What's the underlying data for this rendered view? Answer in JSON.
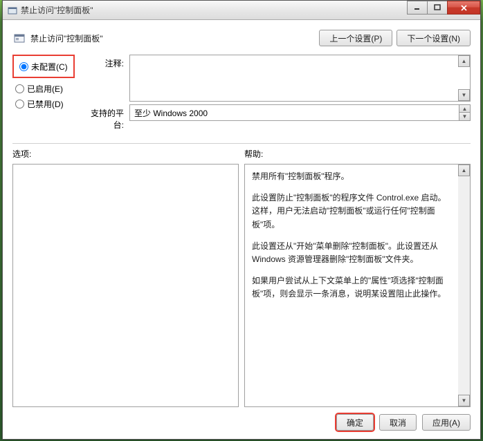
{
  "titlebar": {
    "title": "禁止访问\"控制面板\""
  },
  "header": {
    "title": "禁止访问\"控制面板\"",
    "prev_button": "上一个设置(P)",
    "next_button": "下一个设置(N)"
  },
  "radio": {
    "not_configured": "未配置(C)",
    "enabled": "已启用(E)",
    "disabled": "已禁用(D)",
    "selected": "not_configured"
  },
  "comment": {
    "label": "注释:",
    "value": ""
  },
  "platform": {
    "label": "支持的平台:",
    "value": "至少 Windows 2000"
  },
  "lower": {
    "options_label": "选项:",
    "help_label": "帮助:"
  },
  "help": {
    "p1": "禁用所有\"控制面板\"程序。",
    "p2": "此设置防止\"控制面板\"的程序文件 Control.exe 启动。这样，用户无法启动\"控制面板\"或运行任何\"控制面板\"项。",
    "p3": "此设置还从\"开始\"菜单删除\"控制面板\"。此设置还从 Windows 资源管理器删除\"控制面板\"文件夹。",
    "p4": "如果用户尝试从上下文菜单上的\"属性\"项选择\"控制面板\"项，则会显示一条消息，说明某设置阻止此操作。"
  },
  "footer": {
    "ok": "确定",
    "cancel": "取消",
    "apply": "应用(A)"
  }
}
